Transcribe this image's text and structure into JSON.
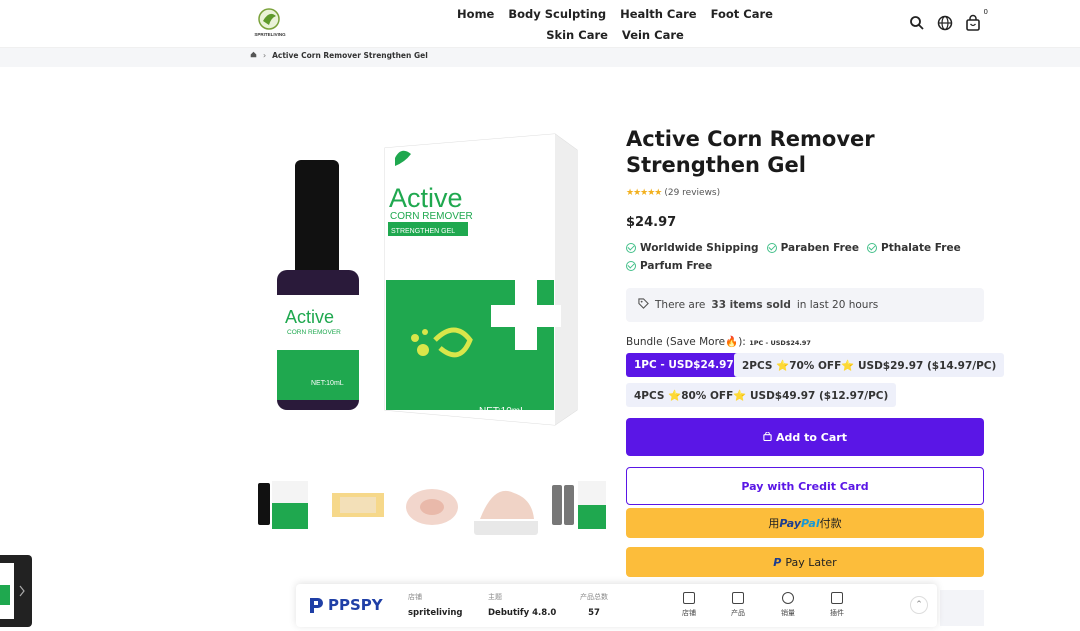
{
  "header": {
    "brand": "SPRITELIVING",
    "nav": [
      "Home",
      "Body Sculpting",
      "Health Care",
      "Foot Care",
      "Skin Care",
      "Vein Care"
    ],
    "cart_count": "0"
  },
  "breadcrumb": {
    "current": "Active Corn Remover Strengthen Gel"
  },
  "product": {
    "title": "Active Corn Remover Strengthen Gel",
    "reviews": "(29 reviews)",
    "price": "$24.97",
    "features": [
      "Worldwide Shipping",
      "Paraben Free",
      "Pthalate Free",
      "Parfum Free"
    ],
    "sold_pre": "There are",
    "sold_bold": "33 items sold",
    "sold_post": "in last 20 hours",
    "bundle_label": "Bundle (Save More🔥):",
    "bundle_selected": "1PC - USD$24.97",
    "bundle_options": [
      "1PC - USD$24.97",
      "2PCS ⭐70% OFF⭐ USD$29.97 ($14.97/PC)",
      "4PCS ⭐80% OFF⭐ USD$49.97 ($12.97/PC)"
    ],
    "add_to_cart": "Add to Cart",
    "pay_credit": "Pay with Credit Card",
    "paypal_pre": "用",
    "paypal_b": "Pay",
    "paypal_c": "Pal",
    "paypal_post": "付款",
    "pay_later": "Pay Later"
  },
  "box": {
    "brand": "Active",
    "sub": "CORN REMOVER",
    "band": "STRENGTHEN GEL",
    "net": "NET:10mL"
  },
  "bottle": {
    "brand": "Active",
    "sub": "CORN REMOVER",
    "net": "NET:10mL"
  },
  "ppspy": {
    "logo": "PPSPY",
    "store_label": "店铺",
    "store_value": "spriteliving",
    "theme_label": "主题",
    "theme_value": "Debutify 4.8.0",
    "products_label": "产品总数",
    "products_value": "57",
    "icons": [
      "店铺",
      "产品",
      "销量",
      "插件"
    ]
  },
  "colors": {
    "accent": "#5a16e6",
    "paypal": "#fcbd3b",
    "check": "#44c08a",
    "product_green": "#1fa84f"
  }
}
